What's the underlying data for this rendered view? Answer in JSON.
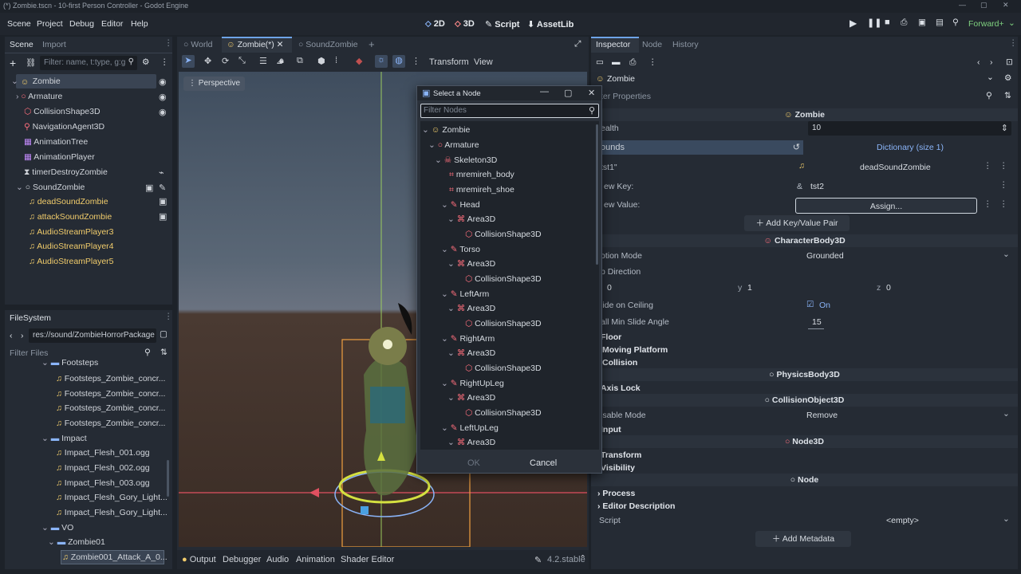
{
  "window": {
    "title": "(*) Zombie.tscn - 10-first Person Controller - Godot Engine"
  },
  "menu": {
    "scene": "Scene",
    "project": "Project",
    "debug": "Debug",
    "editor": "Editor",
    "help": "Help"
  },
  "main_screens": {
    "two_d": "2D",
    "three_d": "3D",
    "script": "Script",
    "assetlib": "AssetLib"
  },
  "renderer": "Forward+",
  "scene_dock": {
    "tab_scene": "Scene",
    "tab_import": "Import",
    "filter_placeholder": "Filter: name, t:type, g:g",
    "nodes": [
      "Zombie",
      "Armature",
      "CollisionShape3D",
      "NavigationAgent3D",
      "AnimationTree",
      "AnimationPlayer",
      "timerDestroyZombie",
      "SoundZombie",
      "deadSoundZombie",
      "attackSoundZombie",
      "AudioStreamPlayer3",
      "AudioStreamPlayer4",
      "AudioStreamPlayer5"
    ]
  },
  "filesystem": {
    "tab": "FileSystem",
    "path": "res://sound/ZombieHorrorPackage",
    "filter_placeholder": "Filter Files",
    "items": [
      "Footsteps",
      "Footsteps_Zombie_concr...",
      "Footsteps_Zombie_concr...",
      "Footsteps_Zombie_concr...",
      "Footsteps_Zombie_concr...",
      "Impact",
      "Impact_Flesh_001.ogg",
      "Impact_Flesh_002.ogg",
      "Impact_Flesh_003.ogg",
      "Impact_Flesh_Gory_Light...",
      "Impact_Flesh_Gory_Light...",
      "VO",
      "Zombie01",
      "Zombie001_Attack_A_0..."
    ]
  },
  "viewport": {
    "tabs": [
      "World",
      "Zombie(*)",
      "SoundZombie"
    ],
    "transform": "Transform",
    "view": "View",
    "perspective": "Perspective"
  },
  "bottom": {
    "output": "Output",
    "debugger": "Debugger",
    "audio": "Audio",
    "animation": "Animation",
    "shader_editor": "Shader Editor",
    "version": "4.2.stable"
  },
  "dialog": {
    "title": "Select a Node",
    "filter_placeholder": "Filter Nodes",
    "ok": "OK",
    "cancel": "Cancel",
    "nodes": [
      "Zombie",
      "Armature",
      "Skeleton3D",
      "mremireh_body",
      "mremireh_shoe",
      "Head",
      "Area3D",
      "CollisionShape3D",
      "Torso",
      "Area3D",
      "CollisionShape3D",
      "LeftArm",
      "Area3D",
      "CollisionShape3D",
      "RightArm",
      "Area3D",
      "CollisionShape3D",
      "RightUpLeg",
      "Area3D",
      "CollisionShape3D",
      "LeftUpLeg",
      "Area3D"
    ]
  },
  "inspector": {
    "tab_inspector": "Inspector",
    "tab_node": "Node",
    "tab_history": "History",
    "object": "Zombie",
    "filter": "ter Properties",
    "header_zombie": "Zombie",
    "health_label": "ealth",
    "health_value": "10",
    "sounds_label": "ounds",
    "sounds_value": "Dictionary (size 1)",
    "key1": "tst1\"",
    "key1_value": "deadSoundZombie",
    "new_key_label": "ew Key:",
    "new_key_value": "tst2",
    "new_key_amp": "&",
    "new_value_label": "ew Value:",
    "assign": "Assign...",
    "add_pair": "Add Key/Value Pair",
    "charbody": "CharacterBody3D",
    "motion_mode_label": "otion Mode",
    "motion_mode_value": "Grounded",
    "up_dir_label": "p Direction",
    "up_x": "0",
    "up_y_label": "y",
    "up_y": "1",
    "up_z_label": "z",
    "up_z": "0",
    "slide_label": "lide on Ceiling",
    "slide_value": "On",
    "wall_label": "all Min Slide Angle",
    "wall_value": "15",
    "floor": "Floor",
    "moving_platform": "Moving Platform",
    "collision": "Collision",
    "physicsbody": "PhysicsBody3D",
    "axis_lock": "Axis Lock",
    "collisionobject": "CollisionObject3D",
    "disable_label": "isable Mode",
    "disable_value": "Remove",
    "input": "Input",
    "node3d": "Node3D",
    "transform": "Transform",
    "visibility": "Visibility",
    "node": "Node",
    "process": "Process",
    "editor_description": "Editor Description",
    "script_label": "Script",
    "script_value": "<empty>",
    "add_metadata": "Add Metadata"
  }
}
